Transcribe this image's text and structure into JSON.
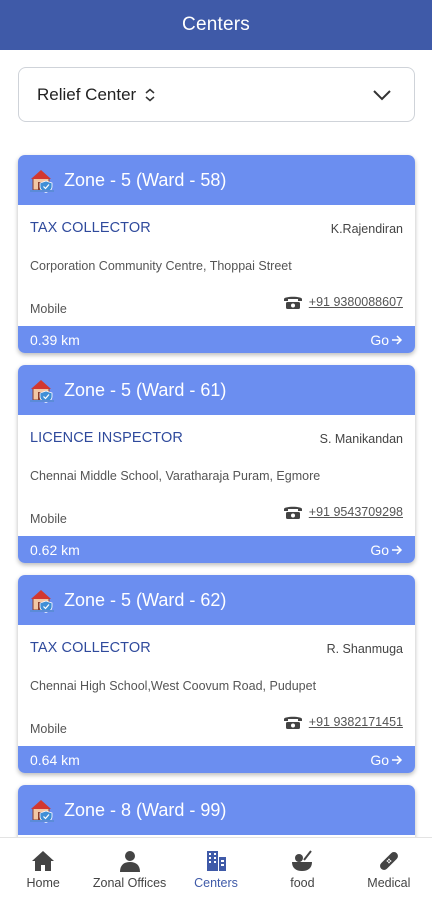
{
  "app_bar": {
    "title": "Centers"
  },
  "filter": {
    "selected": "Relief Center"
  },
  "centers": [
    {
      "zone": "Zone - 5 (Ward - 58)",
      "role": "TAX COLLECTOR",
      "person": "K.Rajendiran",
      "address": "Corporation Community Centre, Thoppai Street",
      "mobile_label": "Mobile",
      "phone": "+91 9380088607",
      "distance": "0.39 km",
      "go": "Go"
    },
    {
      "zone": "Zone - 5 (Ward - 61)",
      "role": "LICENCE INSPECTOR",
      "person": "S. Manikandan",
      "address": "Chennai Middle School, Varatharaja Puram, Egmore",
      "mobile_label": "Mobile",
      "phone": "+91 9543709298",
      "distance": "0.62 km",
      "go": "Go"
    },
    {
      "zone": "Zone - 5 (Ward - 62)",
      "role": "TAX COLLECTOR",
      "person": "R. Shanmuga",
      "address": "Chennai High School,West Coovum Road, Pudupet",
      "mobile_label": "Mobile",
      "phone": "+91 9382171451",
      "distance": "0.64 km",
      "go": "Go"
    },
    {
      "zone": "Zone - 8 (Ward - 99)"
    }
  ],
  "bottom_nav": [
    {
      "label": "Home",
      "icon": "home-icon"
    },
    {
      "label": "Zonal Offices",
      "icon": "person-icon"
    },
    {
      "label": "Centers",
      "icon": "building-icon",
      "active": true
    },
    {
      "label": "food",
      "icon": "food-icon"
    },
    {
      "label": "Medical",
      "icon": "bandage-icon"
    }
  ],
  "colors": {
    "app_bar": "#3f5aa8",
    "card_accent": "#6b8ef0",
    "active_nav": "#3f5aa8"
  }
}
